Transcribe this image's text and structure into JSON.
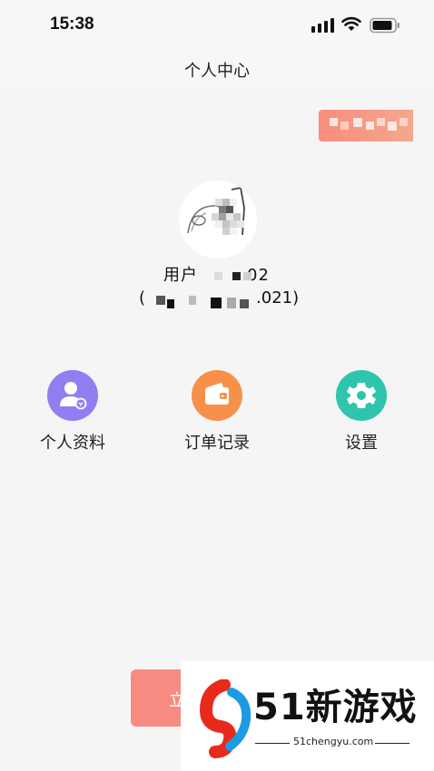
{
  "status_bar": {
    "time": "15:38"
  },
  "nav": {
    "title": "个人中心"
  },
  "profile": {
    "name_visible": "用户",
    "name_suffix": "02",
    "id_prefix": "(",
    "id_suffix": ".021)"
  },
  "actions": [
    {
      "label": "个人资料",
      "icon": "user-profile-icon",
      "color": "#8f7ff0"
    },
    {
      "label": "订单记录",
      "icon": "wallet-icon",
      "color": "#f7914a"
    },
    {
      "label": "设置",
      "icon": "gear-icon",
      "color": "#2fc5ad"
    }
  ],
  "bottom_button": {
    "label": "立"
  },
  "watermark": {
    "brand": "51新游戏",
    "url": "51chengyu.com"
  },
  "colors": {
    "background": "#f5f5f5",
    "promo_badge": "#f78e7c",
    "button": "#f78b82"
  }
}
